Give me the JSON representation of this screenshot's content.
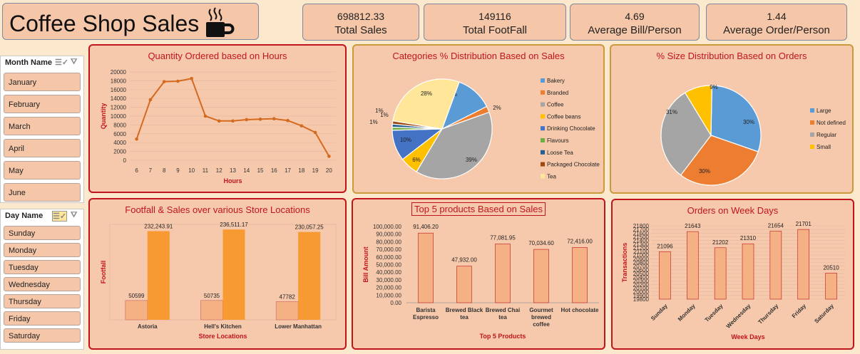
{
  "header": {
    "title": "Coffee Shop Sales",
    "icon": "coffee-cup-icon"
  },
  "kpis": [
    {
      "value": "698812.33",
      "label": "Total Sales"
    },
    {
      "value": "149116",
      "label": "Total FootFall"
    },
    {
      "value": "4.69",
      "label": "Average Bill/Person"
    },
    {
      "value": "1.44",
      "label": "Average Order/Person"
    }
  ],
  "slicers": {
    "month": {
      "title": "Month Name",
      "items": [
        "January",
        "February",
        "March",
        "April",
        "May",
        "June"
      ]
    },
    "day": {
      "title": "Day Name",
      "items": [
        "Sunday",
        "Monday",
        "Tuesday",
        "Wednesday",
        "Thursday",
        "Friday",
        "Saturday"
      ]
    }
  },
  "colors": {
    "accent": "#c0151b",
    "orange": "#f79a32",
    "peach": "#f4b183",
    "line": "#d46a1f"
  },
  "chart_data": [
    {
      "id": "hours",
      "type": "line",
      "title": "Quantity Ordered based on Hours",
      "xlabel": "Hours",
      "ylabel": "Quantity",
      "x": [
        6,
        7,
        8,
        9,
        10,
        11,
        12,
        13,
        14,
        15,
        16,
        17,
        18,
        19,
        20
      ],
      "values": [
        4800,
        13700,
        17800,
        17900,
        18500,
        10000,
        8900,
        8900,
        9200,
        9300,
        9400,
        9000,
        7800,
        6300,
        900
      ],
      "ylim": [
        0,
        20000
      ],
      "yticks": [
        "0",
        "2000",
        "4000",
        "6000",
        "8000",
        "10000",
        "12000",
        "14000",
        "16000",
        "18000",
        "20000"
      ],
      "grid": true
    },
    {
      "id": "categories",
      "type": "pie",
      "title": "Categories % Distribution Based on Sales",
      "slices": [
        {
          "name": "Bakery",
          "value": 12,
          "label": "12%",
          "color": "#5b9bd5"
        },
        {
          "name": "Branded",
          "value": 2,
          "label": "2%",
          "color": "#ed7d31"
        },
        {
          "name": "Coffee",
          "value": 39,
          "label": "39%",
          "color": "#a5a5a5"
        },
        {
          "name": "Coffee beans",
          "value": 6,
          "label": "6%",
          "color": "#ffc000"
        },
        {
          "name": "Drinking Chocolate",
          "value": 10,
          "label": "10%",
          "color": "#4472c4"
        },
        {
          "name": "Flavours",
          "value": 1,
          "label": "1%",
          "color": "#70ad47"
        },
        {
          "name": "Loose Tea",
          "value": 1,
          "label": "1%",
          "color": "#255e91"
        },
        {
          "name": "Packaged Chocolate",
          "value": 1,
          "label": "1%",
          "color": "#9e480e"
        },
        {
          "name": "Tea",
          "value": 28,
          "label": "28%",
          "color": "#ffe699"
        }
      ]
    },
    {
      "id": "sizes",
      "type": "pie",
      "title": "% Size Distribution Based on Orders",
      "slices": [
        {
          "name": "Large",
          "value": 30,
          "label": "30%",
          "color": "#5b9bd5"
        },
        {
          "name": "Not defined",
          "value": 30,
          "label": "30%",
          "color": "#ed7d31"
        },
        {
          "name": "Regular",
          "value": 31,
          "label": "31%",
          "color": "#a5a5a5"
        },
        {
          "name": "Small",
          "value": 9,
          "label": "9%",
          "color": "#ffc000"
        }
      ]
    },
    {
      "id": "stores",
      "type": "bar",
      "title": "Footfall & Sales over various  Store Locations",
      "xlabel": "Store Locations",
      "ylabel": "Footfall",
      "categories": [
        "Astoria",
        "Hell's Kitchen",
        "Lower Manhattan"
      ],
      "series": [
        {
          "values": [
            50599,
            50735,
            47782
          ],
          "labels": [
            "50599",
            "50735",
            "47782"
          ],
          "color": "#f4b183"
        },
        {
          "values": [
            232243.91,
            236511.17,
            230057.25
          ],
          "labels": [
            "232,243.91",
            "236,511.17",
            "230,057.25"
          ],
          "color": "#f79a32"
        }
      ],
      "ylim": [
        0,
        250000
      ]
    },
    {
      "id": "products",
      "type": "bar",
      "title": "Top 5 products Based on Sales",
      "xlabel": "Top 5 Products",
      "ylabel": "Bill Amount",
      "categories": [
        "Barista Espresso",
        "Brewed Black tea",
        "Brewed Chai tea",
        "Gourmet brewed coffee",
        "Hot chocolate"
      ],
      "values": [
        91406.2,
        47932.0,
        77081.95,
        70034.6,
        72416.0
      ],
      "labels": [
        "91,406.20",
        "47,932.00",
        "77,081.95",
        "70,034.60",
        "72,416.00"
      ],
      "ylim": [
        0,
        100000
      ],
      "yticks": [
        "0.00",
        "10,000.00",
        "20,000.00",
        "30,000.00",
        "40,000.00",
        "50,000.00",
        "60,000.00",
        "70,000.00",
        "80,000.00",
        "90,000.00",
        "100,000.00"
      ]
    },
    {
      "id": "weekdays",
      "type": "bar",
      "title": "Orders on Week Days",
      "xlabel": "Week Days",
      "ylabel": "Transactions",
      "categories": [
        "Sunday",
        "Monday",
        "Tuesday",
        "Wednesday",
        "Thursday",
        "Friday",
        "Saturday"
      ],
      "values": [
        21096,
        21643,
        21202,
        21310,
        21654,
        21701,
        20510
      ],
      "labels": [
        "21096",
        "21643",
        "21202",
        "21310",
        "21654",
        "21701",
        "20510"
      ],
      "ylim": [
        19800,
        21800
      ],
      "yticks": [
        "19800",
        "19900",
        "20000",
        "20100",
        "20200",
        "20300",
        "20400",
        "20500",
        "20600",
        "20700",
        "20800",
        "20900",
        "21000",
        "21100",
        "21200",
        "21300",
        "21400",
        "21500",
        "21600",
        "21700",
        "21800"
      ]
    }
  ]
}
